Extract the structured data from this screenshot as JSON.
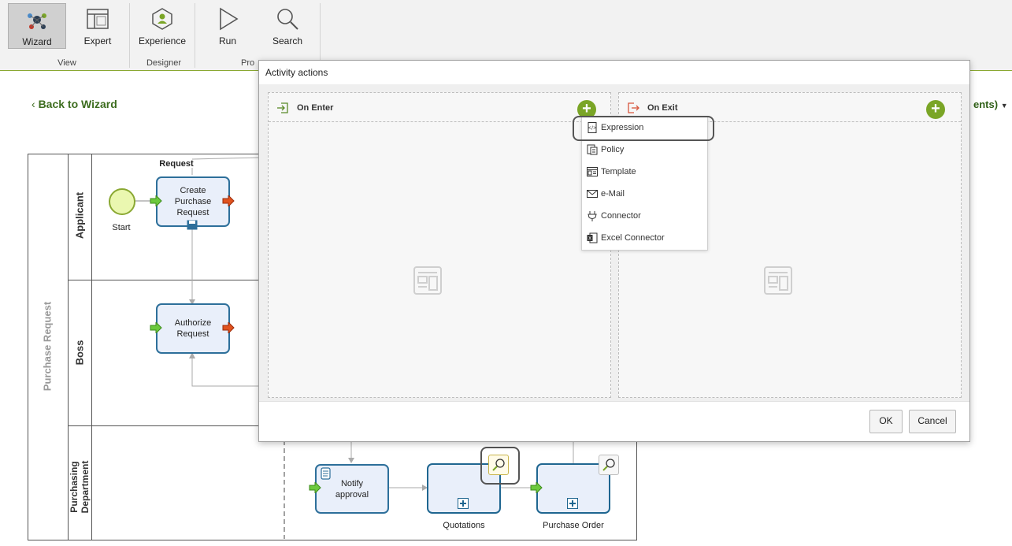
{
  "ribbon": {
    "buttons": [
      {
        "label": "Wizard",
        "icon": "wizard-icon",
        "active": true
      },
      {
        "label": "Expert",
        "icon": "expert-icon"
      },
      {
        "label": "Experience",
        "icon": "experience-icon"
      },
      {
        "label": "Run",
        "icon": "run-icon"
      },
      {
        "label": "Search",
        "icon": "search-icon"
      }
    ],
    "groups": [
      "View",
      "Designer",
      "Pro"
    ]
  },
  "nav": {
    "back_label": "Back to Wizard",
    "right_partial_label": "ents)"
  },
  "diagram": {
    "pool_label": "Purchase Request",
    "lanes": [
      "Applicant",
      "Boss",
      "Purchasing Department"
    ],
    "start_label": "Start",
    "request_label": "Request",
    "tasks": {
      "create": "Create Purchase Request",
      "authorize": "Authorize Request",
      "notify": "Notify approval"
    },
    "subprocesses": {
      "quotations": "Quotations",
      "purchase_order": "Purchase Order"
    }
  },
  "dialog": {
    "title": "Activity actions",
    "on_enter_label": "On Enter",
    "on_exit_label": "On Exit",
    "ok_label": "OK",
    "cancel_label": "Cancel",
    "accent_color": "#7aa526"
  },
  "menu": {
    "items": [
      {
        "label": "Expression",
        "icon": "expression-icon"
      },
      {
        "label": "Policy",
        "icon": "policy-icon"
      },
      {
        "label": "Template",
        "icon": "template-icon"
      },
      {
        "label": "e-Mail",
        "icon": "email-icon"
      },
      {
        "label": "Connector",
        "icon": "connector-icon"
      },
      {
        "label": "Excel Connector",
        "icon": "excel-connector-icon"
      }
    ]
  }
}
